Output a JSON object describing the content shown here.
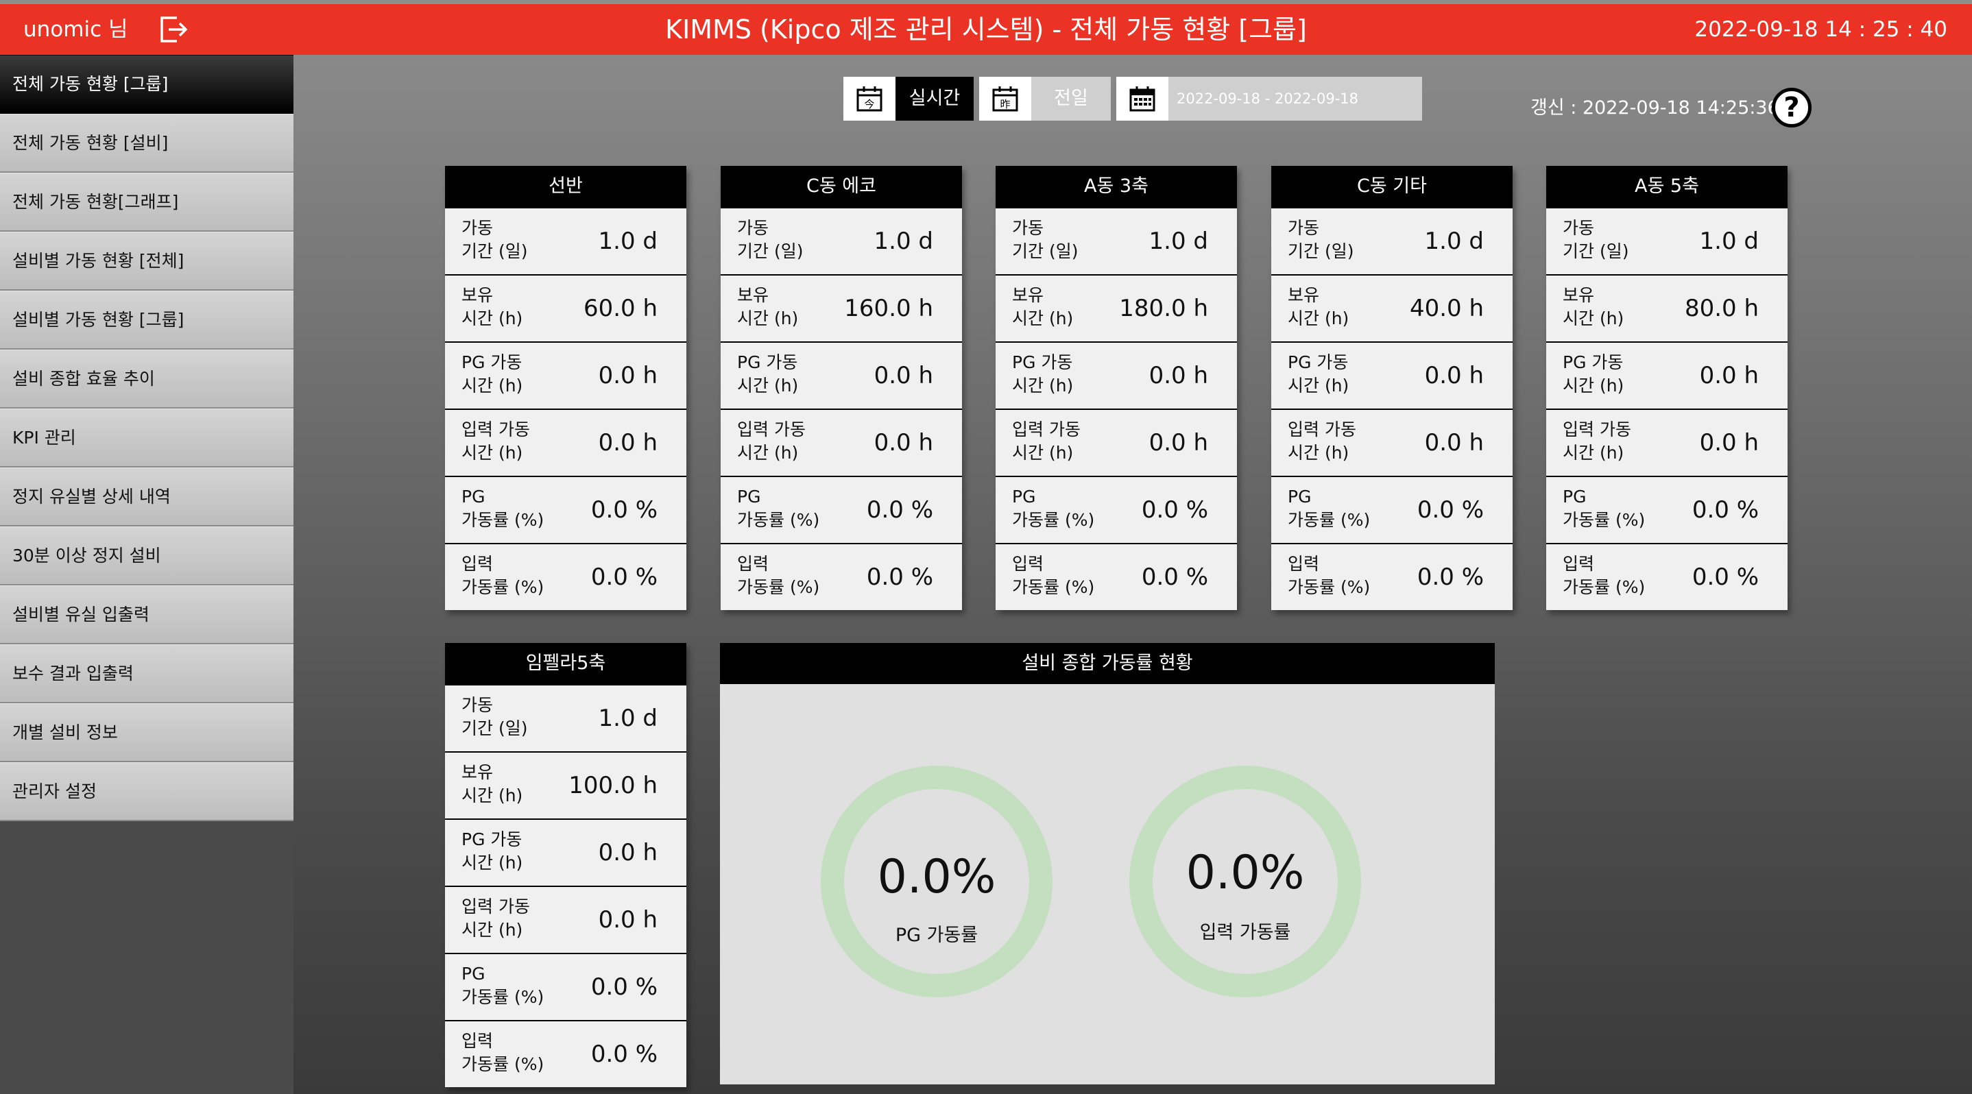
{
  "header": {
    "user": "unomic 님",
    "title": "KIMMS (Kipco 제조 관리 시스템) - 전체 가동 현황 [그룹]",
    "datetime": "2022-09-18 14 : 25 : 40"
  },
  "sidebar": {
    "items": [
      {
        "label": "전체 가동 현황 [그룹]"
      },
      {
        "label": "전체 가동 현황 [설비]"
      },
      {
        "label": "전체 가동 현황[그래프]"
      },
      {
        "label": "설비별 가동 현황 [전체]"
      },
      {
        "label": "설비별 가동 현황 [그룹]"
      },
      {
        "label": "설비 종합 효율 추이"
      },
      {
        "label": "KPI 관리"
      },
      {
        "label": "정지 유실별 상세 내역"
      },
      {
        "label": "30분 이상 정지 설비"
      },
      {
        "label": "설비별 유실 입출력"
      },
      {
        "label": "보수 결과 입출력"
      },
      {
        "label": "개별 설비 정보"
      },
      {
        "label": "관리자 설정"
      }
    ]
  },
  "toolbar": {
    "realtime_label": "실시간",
    "today_icon_text": "今",
    "prevday_label": "전일",
    "prevday_icon_text": "昨",
    "date_range": "2022-09-18 - 2022-09-18",
    "refresh_text": "갱신 : 2022-09-18 14:25:36",
    "help_symbol": "?"
  },
  "row_labels": [
    "가동\n기간 (일)",
    "보유\n시간 (h)",
    "PG 가동\n시간 (h)",
    "입력 가동\n시간 (h)",
    "PG\n가동률 (%)",
    "입력\n가동률 (%)"
  ],
  "cards": [
    {
      "title": "선반",
      "values": [
        "1.0 d",
        "60.0 h",
        "0.0 h",
        "0.0 h",
        "0.0 %",
        "0.0 %"
      ]
    },
    {
      "title": "C동 에코",
      "values": [
        "1.0 d",
        "160.0 h",
        "0.0 h",
        "0.0 h",
        "0.0 %",
        "0.0 %"
      ]
    },
    {
      "title": "A동 3축",
      "values": [
        "1.0 d",
        "180.0 h",
        "0.0 h",
        "0.0 h",
        "0.0 %",
        "0.0 %"
      ]
    },
    {
      "title": "C동 기타",
      "values": [
        "1.0 d",
        "40.0 h",
        "0.0 h",
        "0.0 h",
        "0.0 %",
        "0.0 %"
      ]
    },
    {
      "title": "A동 5축",
      "values": [
        "1.0 d",
        "80.0 h",
        "0.0 h",
        "0.0 h",
        "0.0 %",
        "0.0 %"
      ]
    },
    {
      "title": "임펠라5축",
      "values": [
        "1.0 d",
        "100.0 h",
        "0.0 h",
        "0.0 h",
        "0.0 %",
        "0.0 %"
      ]
    }
  ],
  "summary": {
    "title": "설비 종합 가동률 현황",
    "pg": {
      "value": "0.0%",
      "label": "PG 가동률",
      "fraction": 0.0
    },
    "input": {
      "value": "0.0%",
      "label": "입력 가동률",
      "fraction": 0.0
    },
    "ring_color": "#c3dfbf"
  },
  "colors": {
    "header_bg": "#ea3325",
    "card_header_bg": "#000000",
    "accent": "#ea3325"
  }
}
